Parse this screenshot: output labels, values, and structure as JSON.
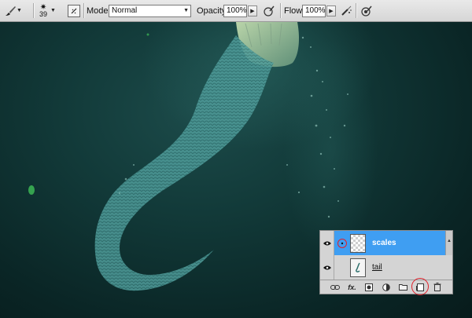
{
  "options_bar": {
    "brush_size": "39",
    "mode_label": "Mode:",
    "mode_value": "Normal",
    "opacity_label": "Opacity:",
    "opacity_value": "100%",
    "flow_label": "Flow:",
    "flow_value": "100%",
    "icons": [
      "brush-tool-icon",
      "brush-preset-icon",
      "toggle-brush-panel-icon",
      "pressure-opacity-icon",
      "airbrush-icon",
      "pressure-size-icon"
    ]
  },
  "layers_panel": {
    "layers": [
      {
        "name": "scales",
        "selected": true,
        "visible": true
      },
      {
        "name": "tail",
        "selected": false,
        "visible": true
      }
    ],
    "footer_icons": [
      "link-layers-icon",
      "fx-icon",
      "add-mask-icon",
      "adjustment-layer-icon",
      "new-group-icon",
      "new-layer-icon",
      "delete-layer-icon"
    ],
    "fx_label": "fx."
  },
  "colors": {
    "selection": "#3f9ef2",
    "canvas_bg": "#0b2a2a",
    "tail_teal": "#4e9c9a",
    "highlight_circle": "#e0202a"
  }
}
